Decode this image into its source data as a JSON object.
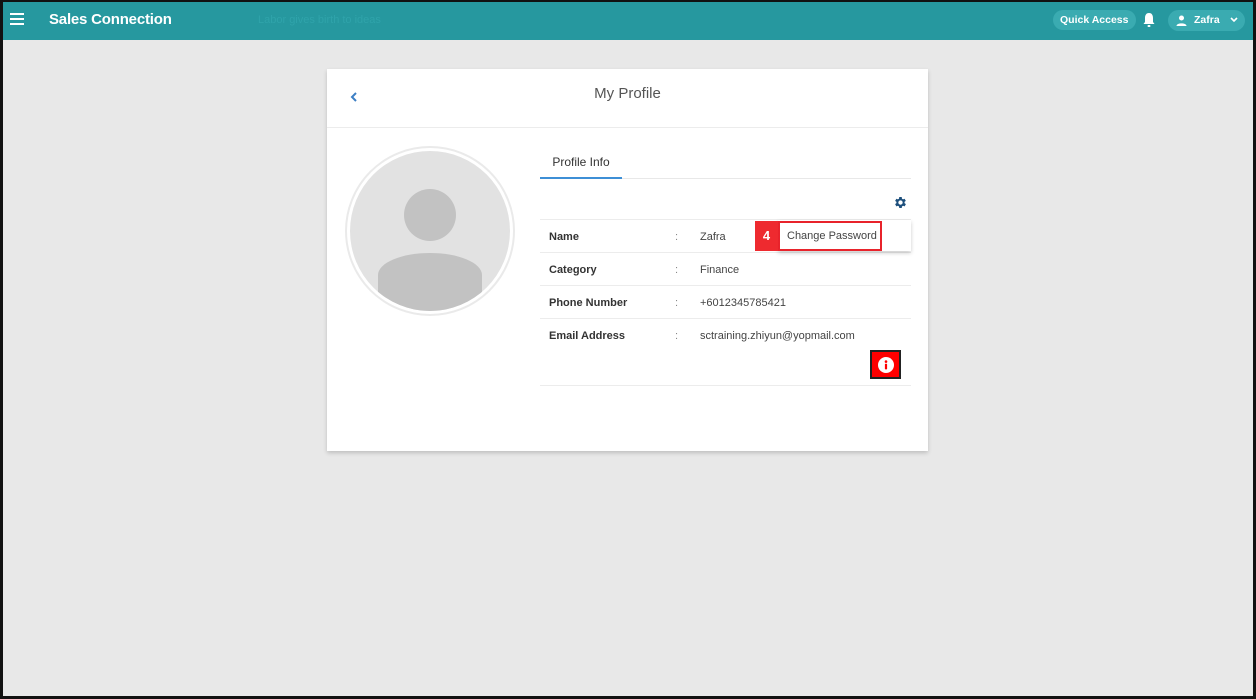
{
  "header": {
    "app_title": "Sales Connection",
    "tagline": "Labor gives birth to ideas",
    "quick_access_label": "Quick Access",
    "user_name": "Zafra",
    "brand_color": "#26989f"
  },
  "card": {
    "title": "My Profile",
    "tabs": [
      {
        "label": "Profile Info",
        "active": true
      }
    ],
    "fields": [
      {
        "label": "Name",
        "separator": ":",
        "value": "Zafra"
      },
      {
        "label": "Category",
        "separator": ":",
        "value": "Finance"
      },
      {
        "label": "Phone Number",
        "separator": ":",
        "value": "+6012345785421"
      },
      {
        "label": "Email Address",
        "separator": ":",
        "value": "sctraining.zhiyun@yopmail.com"
      }
    ]
  },
  "settings_menu": {
    "items": [
      {
        "label": "Change Password"
      }
    ]
  },
  "annotation": {
    "step_number": "4",
    "highlight_color": "#e8232b"
  }
}
